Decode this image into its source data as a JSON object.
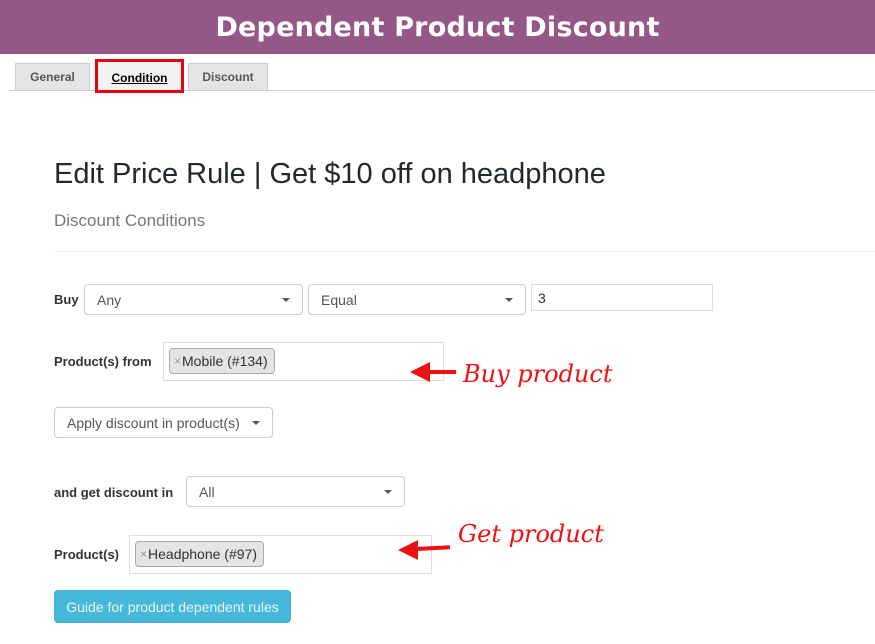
{
  "banner": {
    "title": "Dependent Product Discount",
    "background": "#955787"
  },
  "tabs": [
    {
      "label": "General",
      "active": false
    },
    {
      "label": "Condition",
      "active": true
    },
    {
      "label": "Discount",
      "active": false
    }
  ],
  "page": {
    "title": "Edit Price Rule | Get $10 off on headphone",
    "section_title": "Discount Conditions"
  },
  "form": {
    "buy": {
      "label": "Buy",
      "quantity_type": {
        "selected": "Any"
      },
      "comparison": {
        "selected": "Equal"
      },
      "value": "3"
    },
    "products_from": {
      "label": "Product(s) from",
      "chips": [
        {
          "remove": "×",
          "text": "Mobile (#134)"
        }
      ]
    },
    "apply_mode": {
      "selected": "Apply discount in product(s)"
    },
    "get_discount_in": {
      "label": "and get discount in",
      "selected": "All"
    },
    "products": {
      "label": "Product(s)",
      "chips": [
        {
          "remove": "×",
          "text": "Headphone (#97)"
        }
      ]
    },
    "guide_button": "Guide for product dependent rules"
  },
  "annotations": {
    "buy_product": "Buy product",
    "get_product": "Get product",
    "color": "#ee1111"
  }
}
